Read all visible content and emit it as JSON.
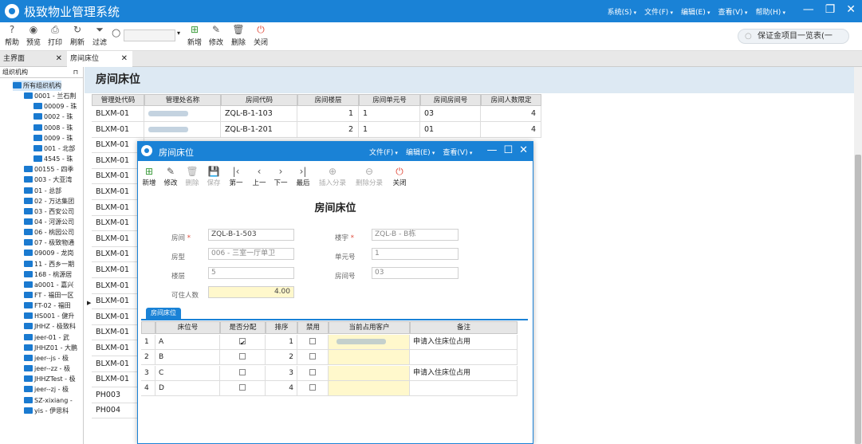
{
  "app": {
    "title": "极致物业管理系统",
    "menus": [
      "系统(S)",
      "文件(F)",
      "编辑(E)",
      "查看(V)",
      "帮助(H)"
    ]
  },
  "toolbar": {
    "items": [
      {
        "label": "帮助",
        "icon": "help-icon"
      },
      {
        "label": "预览",
        "icon": "eye-icon"
      },
      {
        "label": "打印",
        "icon": "printer-icon"
      },
      {
        "label": "刷新",
        "icon": "refresh-icon"
      },
      {
        "label": "过滤",
        "icon": "filter-icon"
      },
      {
        "label": "新增",
        "icon": "add-icon"
      },
      {
        "label": "修改",
        "icon": "edit-icon"
      },
      {
        "label": "删除",
        "icon": "trash-icon"
      },
      {
        "label": "关闭",
        "icon": "power-icon"
      }
    ],
    "right_search": "保证金项目一览表(一"
  },
  "tabs": [
    {
      "label": "主界面"
    },
    {
      "label": "房间床位"
    }
  ],
  "sidebar": {
    "title": "组织机构",
    "items": [
      "所有组织机构",
      "0001 - 兰石荆",
      "00009 - 珠",
      "0002 - 珠",
      "0008 - 珠",
      "0009 - 珠",
      "001 - 北部",
      "4545 - 珠",
      "00155 - 四季",
      "003 - 大亚湾",
      "01 - 总部",
      "02 - 万达集团",
      "03 - 西安公司",
      "04 - 河源公司",
      "06 - 桃园公司",
      "07 - 极致物通",
      "09009 - 龙岗",
      "11 - 西乡一期",
      "168 - 桃源居",
      "a0001 - 嘉兴",
      "FT - 福田一区",
      "FT-02 - 福田",
      "HS001 - 健升",
      "JHHZ - 极致科",
      "jeer-01 - 武",
      "JHHZ01 - 大鹏",
      "jeer--js - 极",
      "jeer--zz - 极",
      "JHHZTest - 极",
      "jeer--zj - 极",
      "SZ-xixiang -",
      "yis - 伊思科"
    ]
  },
  "main": {
    "title": "房间床位",
    "columns": [
      "管理处代码",
      "管理处名称",
      "房间代码",
      "房间楼层",
      "房间单元号",
      "房间房间号",
      "房间人数限定"
    ],
    "rows": [
      {
        "code": "BLXM-01",
        "room": "ZQL-B-1-103",
        "floor": "1",
        "unit": "1",
        "roomno": "03",
        "limit": "4"
      },
      {
        "code": "BLXM-01",
        "room": "ZQL-B-1-201",
        "floor": "2",
        "unit": "1",
        "roomno": "01",
        "limit": "4"
      }
    ],
    "left_codes": [
      "BLXM-01",
      "BLXM-01",
      "BLXM-01",
      "BLXM-01",
      "BLXM-01",
      "BLXM-01",
      "BLXM-01",
      "BLXM-01",
      "BLXM-01",
      "BLXM-01",
      "BLXM-01",
      "BLXM-01",
      "BLXM-01",
      "BLXM-01",
      "BLXM-01",
      "BLXM-01",
      "BLXM-01",
      "BLXM-01",
      "PH003",
      "PH004"
    ]
  },
  "dialog": {
    "title": "房间床位",
    "menus": [
      "文件(F)",
      "编辑(E)",
      "查看(V)"
    ],
    "toolbar": [
      {
        "label": "新增",
        "icon": "add-icon"
      },
      {
        "label": "修改",
        "icon": "edit-icon"
      },
      {
        "label": "删除",
        "icon": "trash-icon"
      },
      {
        "label": "保存",
        "icon": "save-icon"
      },
      {
        "label": "第一",
        "icon": "first-icon"
      },
      {
        "label": "上一",
        "icon": "prev-icon"
      },
      {
        "label": "下一",
        "icon": "next-icon"
      },
      {
        "label": "最后",
        "icon": "last-icon"
      },
      {
        "label": "插入分录",
        "icon": "insert-icon"
      },
      {
        "label": "删除分录",
        "icon": "remove-icon"
      },
      {
        "label": "关闭",
        "icon": "power-icon"
      }
    ],
    "form_title": "房间床位",
    "fields": {
      "room_label": "房间",
      "room": "ZQL-B-1-503",
      "building_label": "楼宇",
      "building": "ZQL-B - B栋",
      "type_label": "房型",
      "type": "006 - 三室一厅单卫",
      "unit_label": "单元号",
      "unit": "1",
      "floor_label": "楼层",
      "floor": "5",
      "roomno_label": "房间号",
      "roomno": "03",
      "capacity_label": "可住人数",
      "capacity": "4.00"
    },
    "sub_tab": "房间床位",
    "sub_columns": [
      "床位号",
      "是否分配",
      "排序",
      "禁用",
      "当前占用客户",
      "备注"
    ],
    "sub_rows": [
      {
        "idx": "1",
        "bed": "A",
        "assigned": true,
        "order": "1",
        "disabled": false,
        "note": "申请入住床位占用"
      },
      {
        "idx": "2",
        "bed": "B",
        "assigned": false,
        "order": "2",
        "disabled": false,
        "note": ""
      },
      {
        "idx": "3",
        "bed": "C",
        "assigned": false,
        "order": "3",
        "disabled": false,
        "note": "申请入住床位占用"
      },
      {
        "idx": "4",
        "bed": "D",
        "assigned": false,
        "order": "4",
        "disabled": false,
        "note": ""
      }
    ]
  },
  "colors": {
    "brand": "#1a82d6",
    "header_band": "#dde9f3",
    "editable_cell": "#fff8cc"
  }
}
